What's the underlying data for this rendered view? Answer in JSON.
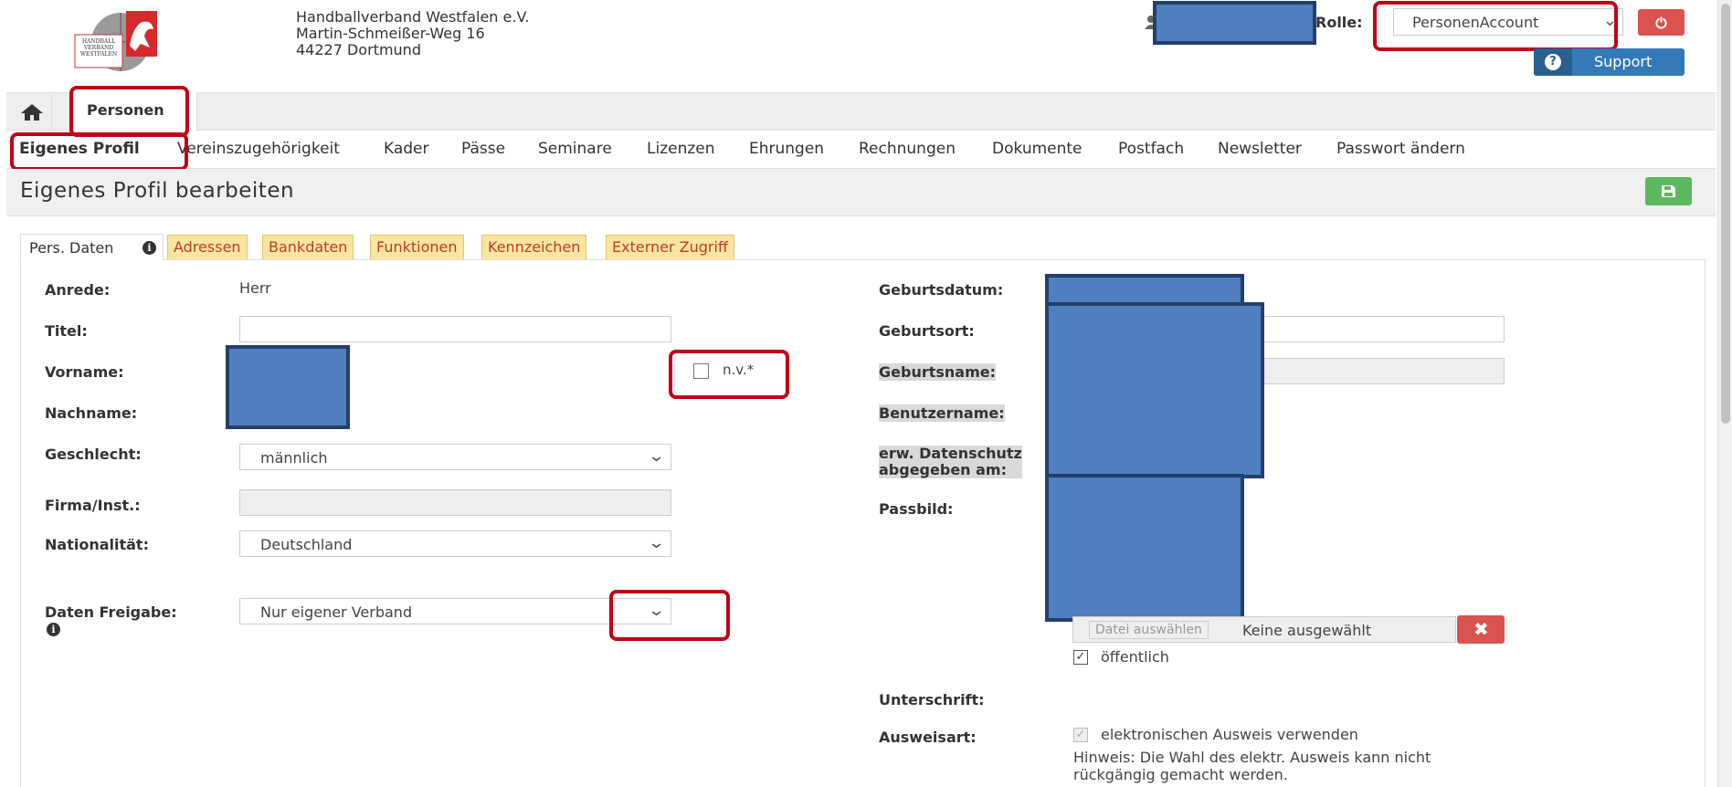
{
  "org": {
    "name": "Handballverband Westfalen e.V.",
    "street": "Martin-Schmeißer-Weg 16",
    "city": "44227 Dortmund",
    "logo_text_1": "HANDBALL",
    "logo_text_2": "VERBAND",
    "logo_text_3": "WESTFALEN"
  },
  "header": {
    "rolle_label": "Rolle:",
    "rolle_value": "PersonenAccount",
    "support_label": "Support"
  },
  "top_tabs": {
    "home_icon": "home-icon",
    "personen": "Personen"
  },
  "subnav": [
    "Eigenes Profil",
    "Vereinszugehörigkeit",
    "Kader",
    "Pässe",
    "Seminare",
    "Lizenzen",
    "Ehrungen",
    "Rechnungen",
    "Dokumente",
    "Postfach",
    "Newsletter",
    "Passwort ändern"
  ],
  "page": {
    "title": "Eigenes Profil bearbeiten",
    "save_icon": "save-icon"
  },
  "form_tabs": {
    "active": "Pers. Daten",
    "others": [
      "Adressen",
      "Bankdaten",
      "Funktionen",
      "Kennzeichen",
      "Externer Zugriff"
    ]
  },
  "left": {
    "anrede_label": "Anrede:",
    "anrede_value": "Herr",
    "titel_label": "Titel:",
    "titel_value": "",
    "vorname_label": "Vorname:",
    "nv_label": "n.v.*",
    "nachname_label": "Nachname:",
    "geschlecht_label": "Geschlecht:",
    "geschlecht_value": "männlich",
    "firma_label": "Firma/Inst.:",
    "firma_value": "",
    "nationalitaet_label": "Nationalität:",
    "nationalitaet_value": "Deutschland",
    "freigabe_label": "Daten Freigabe:",
    "freigabe_value": "Nur eigener Verband"
  },
  "right": {
    "geburtsdatum_label": "Geburtsdatum:",
    "geburtsort_label": "Geburtsort:",
    "geburtsname_label": "Geburtsname:",
    "benutzername_label": "Benutzername:",
    "datenschutz_label_1": "erw. Datenschutz",
    "datenschutz_label_2": "abgegeben am:",
    "passbild_label": "Passbild:",
    "file_button": "Datei auswählen",
    "file_status": "Keine ausgewählt",
    "oeffentlich_label": "öffentlich",
    "unterschrift_label": "Unterschrift:",
    "ausweisart_label": "Ausweisart:",
    "ausweis_checkbox_label": "elektronischen Ausweis verwenden",
    "hinweis_1": "Hinweis: Die Wahl des elektr. Ausweis kann nicht",
    "hinweis_2": "rückgängig gemacht werden."
  },
  "colors": {
    "annotation_red": "#c00018",
    "redaction_blue": "#4e7fbe",
    "tab_yellow": "#f9e5a0",
    "save_green": "#5cb85c",
    "support_blue": "#337ab7",
    "delete_red": "#d9534f"
  }
}
